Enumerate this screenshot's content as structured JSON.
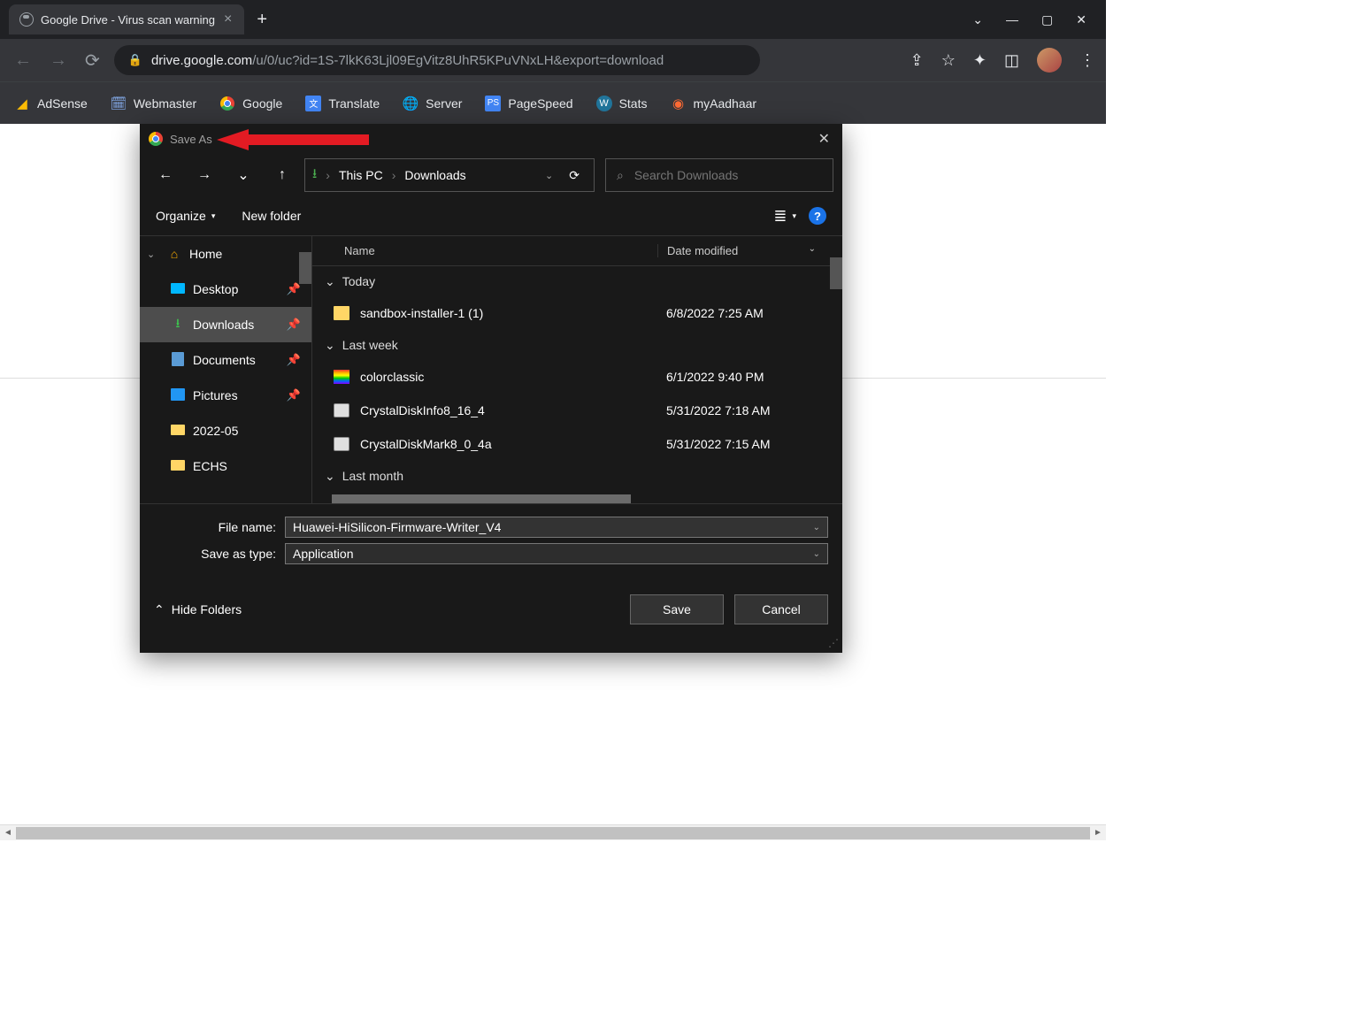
{
  "browser": {
    "tab_title": "Google Drive - Virus scan warning",
    "url_host": "drive.google.com",
    "url_path": "/u/0/uc?id=1S-7lkK63Ljl09EgVitz8UhR5KPuVNxLH&export=download",
    "bookmarks": [
      {
        "label": "AdSense"
      },
      {
        "label": "Webmaster"
      },
      {
        "label": "Google"
      },
      {
        "label": "Translate"
      },
      {
        "label": "Server"
      },
      {
        "label": "PageSpeed"
      },
      {
        "label": "Stats"
      },
      {
        "label": "myAadhaar"
      }
    ]
  },
  "dialog": {
    "title": "Save As",
    "breadcrumb": [
      "This PC",
      "Downloads"
    ],
    "search_placeholder": "Search Downloads",
    "organize_label": "Organize",
    "newfolder_label": "New folder",
    "columns": {
      "name": "Name",
      "date": "Date modified"
    },
    "sidebar": [
      {
        "label": "Home",
        "icon": "home"
      },
      {
        "label": "Desktop",
        "icon": "desktop",
        "pin": true
      },
      {
        "label": "Downloads",
        "icon": "download",
        "pin": true,
        "active": true
      },
      {
        "label": "Documents",
        "icon": "document",
        "pin": true
      },
      {
        "label": "Pictures",
        "icon": "picture",
        "pin": true
      },
      {
        "label": "2022-05",
        "icon": "folder"
      },
      {
        "label": "ECHS",
        "icon": "folder"
      }
    ],
    "groups": [
      {
        "label": "Today",
        "files": [
          {
            "name": "sandbox-installer-1 (1)",
            "date": "6/8/2022 7:25 AM",
            "icon": "folder"
          }
        ]
      },
      {
        "label": "Last week",
        "files": [
          {
            "name": "colorclassic",
            "date": "6/1/2022 9:40 PM",
            "icon": "rainbow"
          },
          {
            "name": "CrystalDiskInfo8_16_4",
            "date": "5/31/2022 7:18 AM",
            "icon": "app"
          },
          {
            "name": "CrystalDiskMark8_0_4a",
            "date": "5/31/2022 7:15 AM",
            "icon": "app"
          }
        ]
      },
      {
        "label": "Last month",
        "files": []
      }
    ],
    "filename_label": "File name:",
    "filename_value": "Huawei-HiSilicon-Firmware-Writer_V4",
    "type_label": "Save as type:",
    "type_value": "Application",
    "hide_folders": "Hide Folders",
    "save": "Save",
    "cancel": "Cancel"
  }
}
